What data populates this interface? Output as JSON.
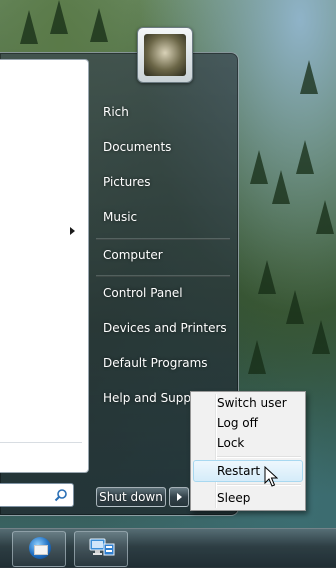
{
  "user": {
    "name": "Rich"
  },
  "start_menu": {
    "right_items": [
      {
        "label": "Rich"
      },
      {
        "label": "Documents"
      },
      {
        "label": "Pictures"
      },
      {
        "label": "Music"
      },
      {
        "label": "Computer"
      },
      {
        "label": "Control Panel"
      },
      {
        "label": "Devices and Printers"
      },
      {
        "label": "Default Programs"
      },
      {
        "label": "Help and Support"
      }
    ],
    "shutdown_label": "Shut down"
  },
  "shutdown_menu": {
    "items": [
      {
        "label": "Switch user"
      },
      {
        "label": "Log off"
      },
      {
        "label": "Lock"
      },
      {
        "label": "Restart"
      },
      {
        "label": "Sleep"
      }
    ],
    "highlighted": "Restart"
  },
  "taskbar": {
    "pinned": [
      {
        "icon": "thunderbird-icon"
      },
      {
        "icon": "remote-desktop-icon"
      }
    ]
  },
  "colors": {
    "menu_text": "#ffffff",
    "popup_background": "#f1f1f1",
    "highlight_border": "#a8d8f0"
  }
}
